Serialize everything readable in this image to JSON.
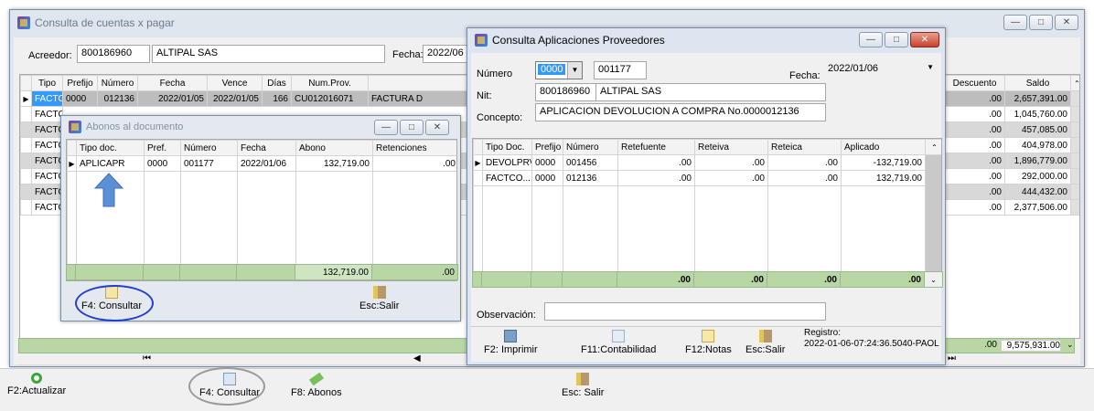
{
  "main": {
    "title": "Consulta de cuentas x pagar",
    "acreedor_label": "Acreedor:",
    "acreedor_code": "800186960",
    "acreedor_name": "ALTIPAL SAS",
    "fecha_label": "Fecha:",
    "fecha_value": "2022/06",
    "columns": [
      "Tipo",
      "Prefijo",
      "Número",
      "Fecha",
      "Vence",
      "Días",
      "Num.Prov."
    ],
    "first_row": {
      "tipo": "FACTC...",
      "prefijo": "0000",
      "numero": "012136",
      "fecha": "2022/01/05",
      "vence": "2022/01/05",
      "dias": "166",
      "numprov": "CU012016071",
      "extra": "FACTURA D"
    },
    "tipo_rows": [
      "FACTC.",
      "FACTC.",
      "FACTC.",
      "FACTC.",
      "FACTC.",
      "FACTC.",
      "FACTC."
    ],
    "right_columns": [
      "Descuento",
      "Saldo"
    ],
    "right_rows": [
      {
        "descuento": ".00",
        "saldo": "2,657,391.00"
      },
      {
        "descuento": ".00",
        "saldo": "1,045,760.00"
      },
      {
        "descuento": ".00",
        "saldo": "457,085.00"
      },
      {
        "descuento": ".00",
        "saldo": "404,978.00"
      },
      {
        "descuento": ".00",
        "saldo": "1,896,779.00"
      },
      {
        "descuento": ".00",
        "saldo": "292,000.00"
      },
      {
        "descuento": ".00",
        "saldo": "444,432.00"
      },
      {
        "descuento": ".00",
        "saldo": "2,377,506.00"
      }
    ],
    "total_descuento": ".00",
    "total_saldo": "9,575,931.00",
    "toolbar": {
      "actualizar": "F2:Actualizar",
      "consultar": "F4: Consultar",
      "abonos": "F8: Abonos",
      "salir": "Esc: Salir"
    }
  },
  "abonos": {
    "title": "Abonos al documento",
    "columns": [
      "Tipo doc.",
      "Pref.",
      "Número",
      "Fecha",
      "Abono",
      "Retenciones"
    ],
    "rows": [
      {
        "tipo": "APLICAPR",
        "pref": "0000",
        "numero": "001177",
        "fecha": "2022/01/06",
        "abono": "132,719.00",
        "retenciones": ".00"
      }
    ],
    "total_abono": "132,719.00",
    "total_retenciones": ".00",
    "consultar": "F4: Consultar",
    "salir": "Esc:Salir"
  },
  "aplicaciones": {
    "title": "Consulta Aplicaciones  Proveedores",
    "numero_label": "Número",
    "numero_prefix": "0000",
    "numero_value": "001177",
    "fecha_label": "Fecha:",
    "fecha_value": "2022/01/06",
    "nit_label": "Nit:",
    "nit_code": "800186960",
    "nit_name": "ALTIPAL SAS",
    "concepto_label": "Concepto:",
    "concepto_value": "APLICACION DEVOLUCION A COMPRA No.0000012136",
    "columns": [
      "Tipo Doc.",
      "Prefijo",
      "Número",
      "Retefuente",
      "Reteiva",
      "Reteica",
      "Aplicado"
    ],
    "rows": [
      {
        "tipo": "DEVOLPRV",
        "prefijo": "0000",
        "numero": "001456",
        "retefuente": ".00",
        "reteiva": ".00",
        "reteica": ".00",
        "aplicado": "-132,719.00"
      },
      {
        "tipo": "FACTCO...",
        "prefijo": "0000",
        "numero": "012136",
        "retefuente": ".00",
        "reteiva": ".00",
        "reteica": ".00",
        "aplicado": "132,719.00"
      }
    ],
    "totals": {
      "retefuente": ".00",
      "reteiva": ".00",
      "reteica": ".00",
      "aplicado": ".00"
    },
    "observacion_label": "Observación:",
    "registro_label": "Registro:",
    "registro_value": "2022-01-06-07:24:36.5040-PAOL",
    "toolbar": {
      "imprimir": "F2: Imprimir",
      "contabilidad": "F11:Contabilidad",
      "notas": "F12:Notas",
      "salir": "Esc:Salir"
    }
  },
  "colors": {
    "selected": "#3399ff",
    "totals": "#b9d7a4",
    "highlight_circle": "#1f3fd1"
  }
}
